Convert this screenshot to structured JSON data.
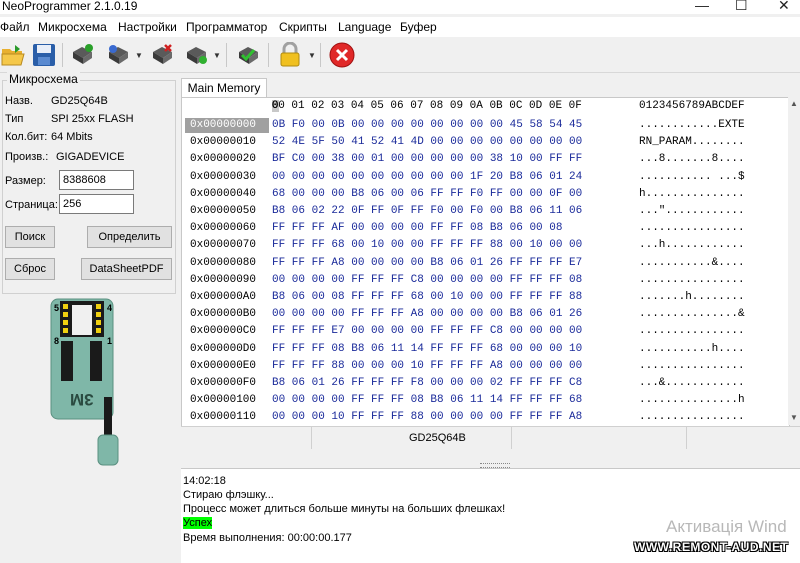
{
  "window": {
    "title": "NeoProgrammer 2.1.0.19",
    "min_symbol": "—",
    "max_symbol": "☐",
    "close_symbol": "✕"
  },
  "menu": [
    "Файл",
    "Микросхема",
    "Настройки",
    "Программатор",
    "Скрипты",
    "Language",
    "Буфер"
  ],
  "toolbar_icons": [
    "open-folder-icon",
    "save-disk-icon",
    "read-chip-icon",
    "write-chip-icon",
    "erase-chip-icon",
    "verify-chip-icon",
    "auto-detect-icon",
    "lock-icon",
    "stop-icon"
  ],
  "chip": {
    "group_title": "Микросхема",
    "name_label": "Назв.",
    "name_value": "GD25Q64B",
    "type_label": "Тип",
    "type_value": "SPI 25xx FLASH",
    "bits_label": "Кол.бит:",
    "bits_value": "64 Mbits",
    "maker_label": "Произв.:",
    "maker_value": "GIGADEVICE",
    "size_label": "Размер:",
    "size_value": "8388608",
    "page_label": "Страница:",
    "page_value": "256"
  },
  "buttons": {
    "search": "Поиск",
    "detect": "Определить",
    "reset": "Сброс",
    "datasheet": "DataSheetPDF"
  },
  "socket": {
    "pin5": "5",
    "pin4": "4",
    "pin8": "8",
    "pin1": "1",
    "mark": "3M"
  },
  "tab": {
    "label": "Main Memory"
  },
  "hex": {
    "header_cols": "00 01 02 03 04 05 06 07 08 09 0A 0B 0C 0D 0E 0F",
    "header_ascii": "0123456789ABCDEF",
    "rows": [
      {
        "addr": "0x00000000",
        "bytes": "0B F0 00 0B 00 00 00 00 00 00 00 00 45 58 54 45",
        "ascii": "............EXTE"
      },
      {
        "addr": "0x00000010",
        "bytes": "52 4E 5F 50 41 52 41 4D 00 00 00 00 00 00 00 00",
        "ascii": "RN_PARAM........"
      },
      {
        "addr": "0x00000020",
        "bytes": "BF C0 00 38 00 01 00 00 00 00 00 38 10 00 FF FF",
        "ascii": "...8.......8...."
      },
      {
        "addr": "0x00000030",
        "bytes": "00 00 00 00 00 00 00 00 00 00 1F 20 B8 06 01 24",
        "ascii": "........... ...$"
      },
      {
        "addr": "0x00000040",
        "bytes": "68 00 00 00 B8 06 00 06 FF FF F0 FF 00 00 0F 00",
        "ascii": "h..............."
      },
      {
        "addr": "0x00000050",
        "bytes": "B8 06 02 22 0F FF 0F FF F0 00 F0 00 B8 06 11 06",
        "ascii": "...\"............"
      },
      {
        "addr": "0x00000060",
        "bytes": "FF FF FF AF 00 00 00 00 FF FF 08 B8 06 00 08",
        "ascii": "................"
      },
      {
        "addr": "0x00000070",
        "bytes": "FF FF FF 68 00 10 00 00 FF FF FF 88 00 10 00 00",
        "ascii": "...h............"
      },
      {
        "addr": "0x00000080",
        "bytes": "FF FF FF A8 00 00 00 00 B8 06 01 26 FF FF FF E7",
        "ascii": "...........&...."
      },
      {
        "addr": "0x00000090",
        "bytes": "00 00 00 00 FF FF FF C8 00 00 00 00 FF FF FF 08",
        "ascii": "................"
      },
      {
        "addr": "0x000000A0",
        "bytes": "B8 06 00 08 FF FF FF 68 00 10 00 00 FF FF FF 88",
        "ascii": ".......h........"
      },
      {
        "addr": "0x000000B0",
        "bytes": "00 00 00 00 FF FF FF A8 00 00 00 00 B8 06 01 26",
        "ascii": "...............&"
      },
      {
        "addr": "0x000000C0",
        "bytes": "FF FF FF E7 00 00 00 00 FF FF FF C8 00 00 00 00",
        "ascii": "................"
      },
      {
        "addr": "0x000000D0",
        "bytes": "FF FF FF 08 B8 06 11 14 FF FF FF 68 00 00 00 10",
        "ascii": "...........h...."
      },
      {
        "addr": "0x000000E0",
        "bytes": "FF FF FF 88 00 00 00 10 FF FF FF A8 00 00 00 00",
        "ascii": "................"
      },
      {
        "addr": "0x000000F0",
        "bytes": "B8 06 01 26 FF FF FF F8 00 00 00 02 FF FF FF C8",
        "ascii": "...&............"
      },
      {
        "addr": "0x00000100",
        "bytes": "00 00 00 00 FF FF FF 08 B8 06 11 14 FF FF FF 68",
        "ascii": "...............h"
      },
      {
        "addr": "0x00000110",
        "bytes": "00 00 00 10 FF FF FF 88 00 00 00 00 FF FF FF A8",
        "ascii": "................"
      }
    ]
  },
  "status": {
    "chip_name": "GD25Q64B"
  },
  "log": {
    "time": "14:02:18",
    "line1": "Стираю флэшку...",
    "line2": "Процесс может длиться больше минуты на больших флешках!",
    "success": "Успех",
    "duration": "Время выполнения: 00:00:00.177",
    "success_color": "#00ff00"
  },
  "overlay": {
    "watermark": "Активація Wind",
    "site": "WWW.REMONT-AUD.NET"
  }
}
